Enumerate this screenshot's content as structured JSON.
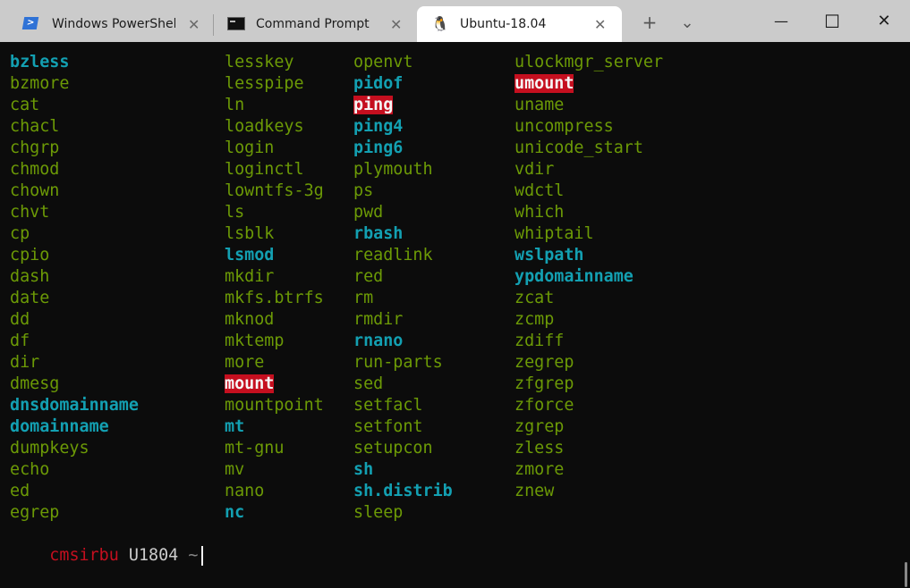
{
  "tabs": [
    {
      "title": "Windows PowerShell",
      "icon": "powershell-icon"
    },
    {
      "title": "Command Prompt",
      "icon": "cmd-icon"
    },
    {
      "title": "Ubuntu-18.04",
      "icon": "tux-icon",
      "active": true
    }
  ],
  "tab_close_glyph": "✕",
  "new_tab_glyph": "+",
  "dropdown_glyph": "⌄",
  "window": {
    "minimize": "—",
    "maximize": "☐",
    "close": "✕"
  },
  "colors": {
    "green": "#6c9a06",
    "cyan": "#13a0b2",
    "highlight_bg": "#c50f1f",
    "prompt_user": "#c50f1f"
  },
  "listing": {
    "columns": [
      [
        {
          "name": "bzless",
          "style": "cyan"
        },
        {
          "name": "bzmore",
          "style": "green"
        },
        {
          "name": "cat",
          "style": "green"
        },
        {
          "name": "chacl",
          "style": "green"
        },
        {
          "name": "chgrp",
          "style": "green"
        },
        {
          "name": "chmod",
          "style": "green"
        },
        {
          "name": "chown",
          "style": "green"
        },
        {
          "name": "chvt",
          "style": "green"
        },
        {
          "name": "cp",
          "style": "green"
        },
        {
          "name": "cpio",
          "style": "green"
        },
        {
          "name": "dash",
          "style": "green"
        },
        {
          "name": "date",
          "style": "green"
        },
        {
          "name": "dd",
          "style": "green"
        },
        {
          "name": "df",
          "style": "green"
        },
        {
          "name": "dir",
          "style": "green"
        },
        {
          "name": "dmesg",
          "style": "green"
        },
        {
          "name": "dnsdomainname",
          "style": "cyan"
        },
        {
          "name": "domainname",
          "style": "cyan"
        },
        {
          "name": "dumpkeys",
          "style": "green"
        },
        {
          "name": "echo",
          "style": "green"
        },
        {
          "name": "ed",
          "style": "green"
        },
        {
          "name": "egrep",
          "style": "green"
        }
      ],
      [
        {
          "name": "lesskey",
          "style": "green"
        },
        {
          "name": "lesspipe",
          "style": "green"
        },
        {
          "name": "ln",
          "style": "green"
        },
        {
          "name": "loadkeys",
          "style": "green"
        },
        {
          "name": "login",
          "style": "green"
        },
        {
          "name": "loginctl",
          "style": "green"
        },
        {
          "name": "lowntfs-3g",
          "style": "green"
        },
        {
          "name": "ls",
          "style": "green"
        },
        {
          "name": "lsblk",
          "style": "green"
        },
        {
          "name": "lsmod",
          "style": "cyan"
        },
        {
          "name": "mkdir",
          "style": "green"
        },
        {
          "name": "mkfs.btrfs",
          "style": "green"
        },
        {
          "name": "mknod",
          "style": "green"
        },
        {
          "name": "mktemp",
          "style": "green"
        },
        {
          "name": "more",
          "style": "green"
        },
        {
          "name": "mount",
          "style": "hl"
        },
        {
          "name": "mountpoint",
          "style": "green"
        },
        {
          "name": "mt",
          "style": "cyan"
        },
        {
          "name": "mt-gnu",
          "style": "green"
        },
        {
          "name": "mv",
          "style": "green"
        },
        {
          "name": "nano",
          "style": "green"
        },
        {
          "name": "nc",
          "style": "cyan"
        }
      ],
      [
        {
          "name": "openvt",
          "style": "green"
        },
        {
          "name": "pidof",
          "style": "cyan"
        },
        {
          "name": "ping",
          "style": "hl"
        },
        {
          "name": "ping4",
          "style": "cyan"
        },
        {
          "name": "ping6",
          "style": "cyan"
        },
        {
          "name": "plymouth",
          "style": "green"
        },
        {
          "name": "ps",
          "style": "green"
        },
        {
          "name": "pwd",
          "style": "green"
        },
        {
          "name": "rbash",
          "style": "cyan"
        },
        {
          "name": "readlink",
          "style": "green"
        },
        {
          "name": "red",
          "style": "green"
        },
        {
          "name": "rm",
          "style": "green"
        },
        {
          "name": "rmdir",
          "style": "green"
        },
        {
          "name": "rnano",
          "style": "cyan"
        },
        {
          "name": "run-parts",
          "style": "green"
        },
        {
          "name": "sed",
          "style": "green"
        },
        {
          "name": "setfacl",
          "style": "green"
        },
        {
          "name": "setfont",
          "style": "green"
        },
        {
          "name": "setupcon",
          "style": "green"
        },
        {
          "name": "sh",
          "style": "cyan"
        },
        {
          "name": "sh.distrib",
          "style": "cyan"
        },
        {
          "name": "sleep",
          "style": "green"
        }
      ],
      [
        {
          "name": "ulockmgr_server",
          "style": "green"
        },
        {
          "name": "umount",
          "style": "hl"
        },
        {
          "name": "uname",
          "style": "green"
        },
        {
          "name": "uncompress",
          "style": "green"
        },
        {
          "name": "unicode_start",
          "style": "green"
        },
        {
          "name": "vdir",
          "style": "green"
        },
        {
          "name": "wdctl",
          "style": "green"
        },
        {
          "name": "which",
          "style": "green"
        },
        {
          "name": "whiptail",
          "style": "green"
        },
        {
          "name": "wslpath",
          "style": "cyan"
        },
        {
          "name": "ypdomainname",
          "style": "cyan"
        },
        {
          "name": "zcat",
          "style": "green"
        },
        {
          "name": "zcmp",
          "style": "green"
        },
        {
          "name": "zdiff",
          "style": "green"
        },
        {
          "name": "zegrep",
          "style": "green"
        },
        {
          "name": "zfgrep",
          "style": "green"
        },
        {
          "name": "zforce",
          "style": "green"
        },
        {
          "name": "zgrep",
          "style": "green"
        },
        {
          "name": "zless",
          "style": "green"
        },
        {
          "name": "zmore",
          "style": "green"
        },
        {
          "name": "znew",
          "style": "green"
        }
      ]
    ]
  },
  "prompt": {
    "user": "cmsirbu",
    "host": "U1804",
    "path": "~"
  }
}
